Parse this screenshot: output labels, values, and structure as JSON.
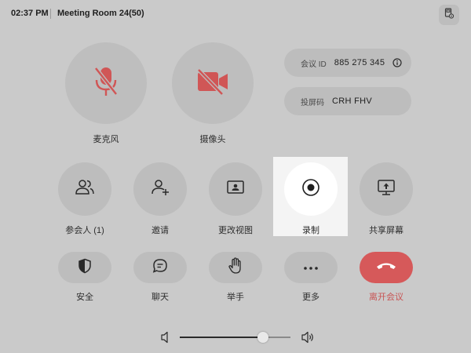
{
  "header": {
    "time": "02:37 PM",
    "room": "Meeting Room 24(50)",
    "corner_icon": "device-info-icon"
  },
  "media": {
    "mic_label": "麦克风",
    "mic_icon": "mic-off-icon",
    "camera_label": "摄像头",
    "camera_icon": "video-off-icon",
    "off_color": "#d05656"
  },
  "info": {
    "meeting_id_label": "会议 ID",
    "meeting_id_value": "885 275 345",
    "share_code_label": "投屏码",
    "share_code_value": "CRH FHV"
  },
  "actions": {
    "participants": "参会人 (1)",
    "invite": "邀请",
    "change_view": "更改视图",
    "record": "录制",
    "share_screen": "共享屏幕"
  },
  "bottom": {
    "security": "安全",
    "chat": "聊天",
    "raise_hand": "举手",
    "more": "更多",
    "leave": "离开会议",
    "leave_color": "#d6595a"
  },
  "volume": {
    "level": 0.75
  }
}
